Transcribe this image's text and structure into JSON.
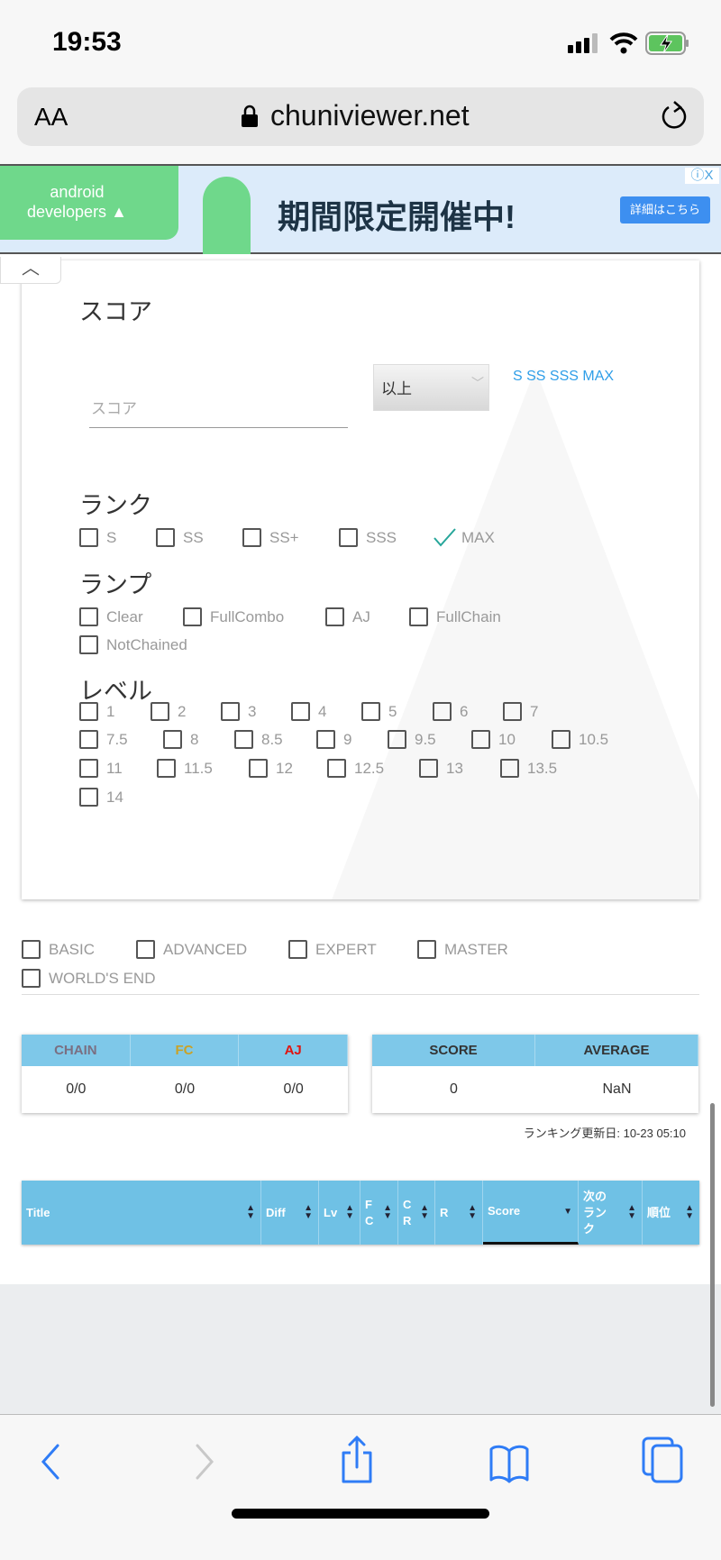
{
  "status_bar": {
    "time": "19:53",
    "signal_icon": "signal-icon",
    "wifi_icon": "wifi-icon",
    "battery_icon": "battery-charging-icon"
  },
  "browser": {
    "text_size_label": "AA",
    "url": "chuniviewer.net",
    "lock_icon": "lock-icon",
    "reload_icon": "reload-icon"
  },
  "ad": {
    "brand_line1": "android",
    "brand_line2": "developers",
    "headline": "期間限定開催中!",
    "cta": "詳細はこちら",
    "info": "ⓘX"
  },
  "filter": {
    "collapse_icon": "chevron-up-icon",
    "score": {
      "heading": "スコア",
      "placeholder": "スコア",
      "comparison": "以上",
      "rank_links": "S SS SSS MAX"
    },
    "rank": {
      "heading": "ランク",
      "options": [
        {
          "label": "S",
          "checked": false
        },
        {
          "label": "SS",
          "checked": false
        },
        {
          "label": "SS+",
          "checked": false
        },
        {
          "label": "SSS",
          "checked": false
        },
        {
          "label": "MAX",
          "checked": true
        }
      ]
    },
    "lamp": {
      "heading": "ランプ",
      "options": [
        {
          "label": "Clear"
        },
        {
          "label": "FullCombo"
        },
        {
          "label": "AJ"
        },
        {
          "label": "FullChain"
        },
        {
          "label": "NotChained"
        }
      ]
    },
    "level": {
      "heading": "レベル",
      "options": [
        "1",
        "2",
        "3",
        "4",
        "5",
        "6",
        "7",
        "7.5",
        "8",
        "8.5",
        "9",
        "9.5",
        "10",
        "10.5",
        "11",
        "11.5",
        "12",
        "12.5",
        "13",
        "13.5",
        "14"
      ]
    }
  },
  "difficulty": {
    "options": [
      "BASIC",
      "ADVANCED",
      "EXPERT",
      "MASTER",
      "WORLD'S END"
    ]
  },
  "stats_lamp": {
    "headers": [
      {
        "label": "CHAIN",
        "color": "#7a6f82"
      },
      {
        "label": "FC",
        "color": "#c9a227"
      },
      {
        "label": "AJ",
        "color": "#e0140f"
      }
    ],
    "values": [
      "0/0",
      "0/0",
      "0/0"
    ]
  },
  "stats_score": {
    "headers": [
      "SCORE",
      "AVERAGE"
    ],
    "values": [
      "0",
      "NaN"
    ]
  },
  "ranking_updated": "ランキング更新日: 10-23 05:10",
  "table": {
    "columns": [
      "Title",
      "Diff",
      "Lv",
      "F\nC",
      "C\nR",
      "R",
      "Score",
      "次の\nラン\nク",
      "順位"
    ],
    "sorted_column": "Score",
    "sort_direction": "desc"
  },
  "toolbar": {
    "icons": [
      "back-icon",
      "forward-icon",
      "share-icon",
      "bookmarks-icon",
      "tabs-icon"
    ]
  }
}
